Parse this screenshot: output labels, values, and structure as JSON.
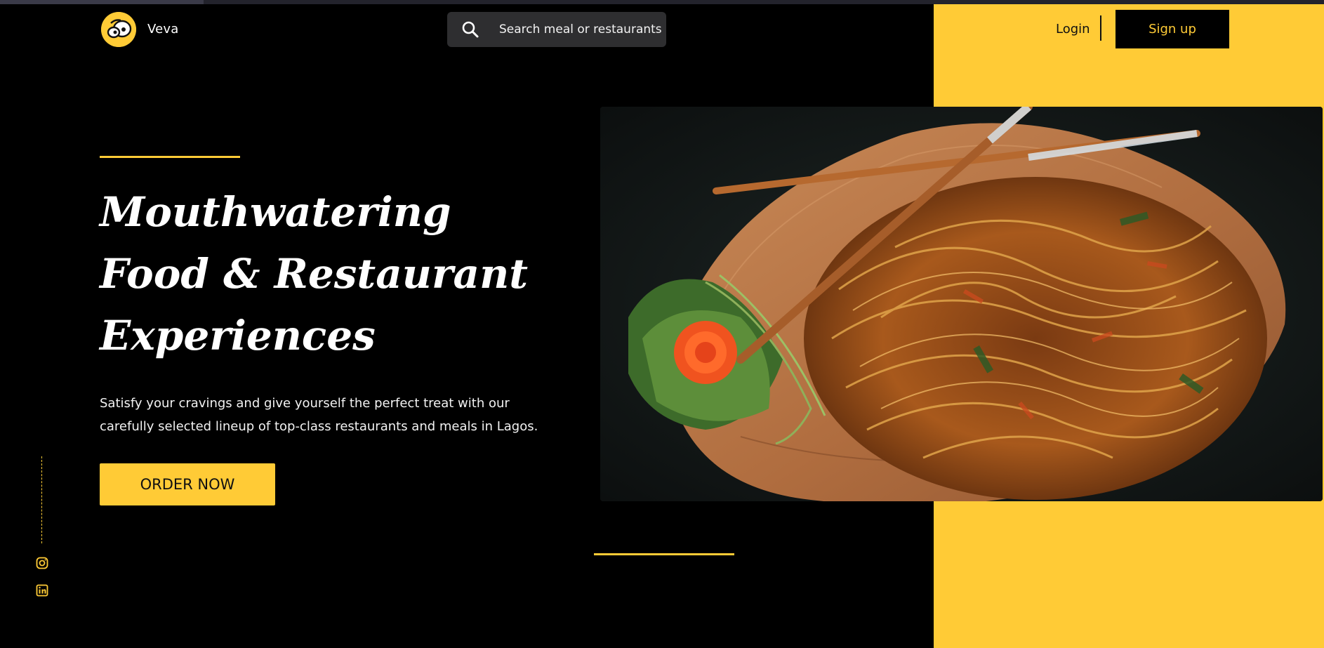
{
  "header": {
    "brand": "Veva",
    "search_placeholder": "Search meal or restaurants",
    "login_label": "Login",
    "signup_label": "Sign up"
  },
  "hero": {
    "headline_lines": [
      "Mouthwatering",
      "Food & Restaurant",
      "Experiences"
    ],
    "description": "Satisfy your cravings and give yourself the perfect treat with our carefully selected lineup of top-class restaurants and meals in Lagos.",
    "cta_label": "ORDER NOW"
  },
  "social": {
    "icons": [
      "instagram-icon",
      "linkedin-icon"
    ]
  },
  "colors": {
    "accent": "#ffcb36",
    "background": "#000000",
    "search_bg": "#2e2e30"
  }
}
